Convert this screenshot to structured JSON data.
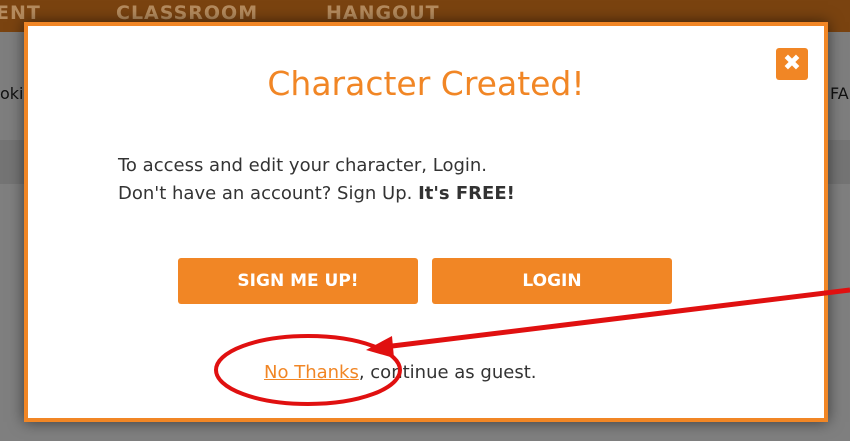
{
  "nav": {
    "items": [
      "ENT",
      "CLASSROOM",
      "HANGOUT"
    ]
  },
  "background": {
    "left_fragment": "oki",
    "right_fragment": "FA"
  },
  "modal": {
    "title": "Character Created!",
    "close_glyph": "✖",
    "body_line1": "To access and edit your character, Login.",
    "body_line2_prefix": "Don't have an account? Sign Up. ",
    "body_line2_bold": "It's FREE!",
    "signup_label": "SIGN ME UP!",
    "login_label": "LOGIN",
    "no_thanks_link": "No Thanks",
    "guest_suffix": ", continue as guest."
  },
  "annotation": {
    "color": "#e01010",
    "accent": "#f18625"
  }
}
